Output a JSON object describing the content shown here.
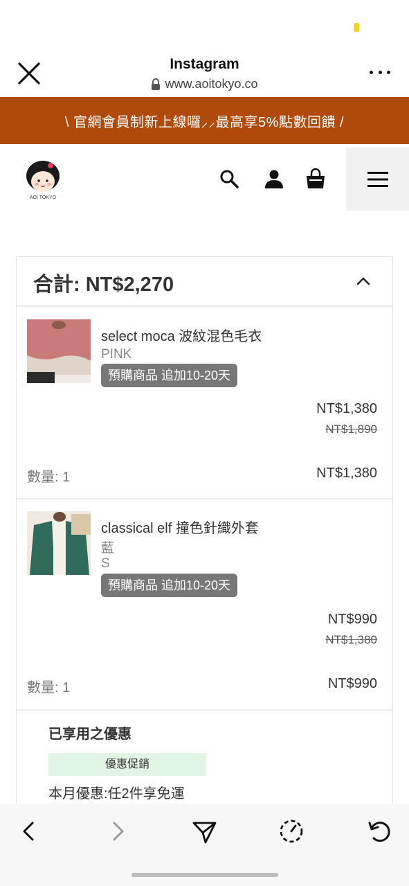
{
  "browser": {
    "title": "Instagram",
    "url": "www.aoitokyo.co"
  },
  "promo_banner": {
    "text": "\\ 官網會員制新上線囉⸝⸝最高享5%點數回饋 /"
  },
  "site": {
    "logo_text": "AOI TOKYO"
  },
  "cart": {
    "total_label": "合計: NT$2,270",
    "items": [
      {
        "name": "select moca 波紋混色毛衣",
        "variants": [
          "PINK"
        ],
        "badge": "預購商品 追加10-20天",
        "price": "NT$1,380",
        "original_price": "NT$1,890",
        "quantity_label": "數量: 1",
        "line_total": "NT$1,380"
      },
      {
        "name": "classical elf 撞色針織外套",
        "variants": [
          "藍",
          "S"
        ],
        "badge": "預購商品 追加10-20天",
        "price": "NT$990",
        "original_price": "NT$1,380",
        "quantity_label": "數量: 1",
        "line_total": "NT$990"
      }
    ],
    "promotions": {
      "title": "已享用之優惠",
      "tag": "優惠促銷",
      "detail": "本月優惠:任2件享免運"
    }
  },
  "colors": {
    "banner": "#b04a0a",
    "badge": "#777777",
    "promo_tag_bg": "#e1f5e4"
  }
}
